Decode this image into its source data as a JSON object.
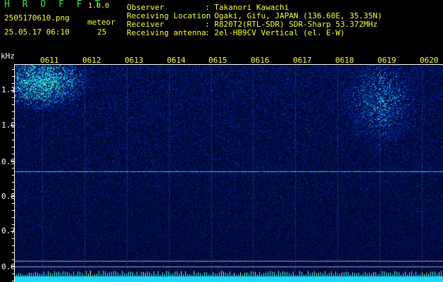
{
  "header": {
    "app_title": "H R O F F T",
    "app_version": "1.0.0",
    "file_name": "2505170610.png",
    "datetime": "25.05.17 06:10",
    "mode_label": "meteor",
    "count": "25"
  },
  "info": [
    {
      "label": "Observer",
      "value": ": Takanori Kawachi"
    },
    {
      "label": "Receiving Location",
      "value": ": Ogaki, Gifu, JAPAN (136.60E, 35.35N)"
    },
    {
      "label": "Receiver",
      "value": ": R820T2(RTL-SDR) SDR-Sharp 53.372MHz"
    },
    {
      "label": "Receiving antenna",
      "value": ": 2el-HB9CV Vertical (el. E-W)"
    }
  ],
  "spectrogram": {
    "y_unit": "kHz",
    "y_ticks": [
      "1.1",
      "1.0",
      "0.9",
      "0.8",
      "0.7",
      "0.6"
    ],
    "y_range": [
      0.58,
      1.2
    ],
    "x_ticks": [
      "0611",
      "0612",
      "0613",
      "0614",
      "0615",
      "0616",
      "0617",
      "0618",
      "0619",
      "0620"
    ],
    "carrier_khz": 0.895,
    "colors": {
      "background": "#020722",
      "signal": "#1a4cff",
      "strong": "#36ffd0",
      "label": "#ffff33",
      "text": "#35e35a"
    }
  }
}
